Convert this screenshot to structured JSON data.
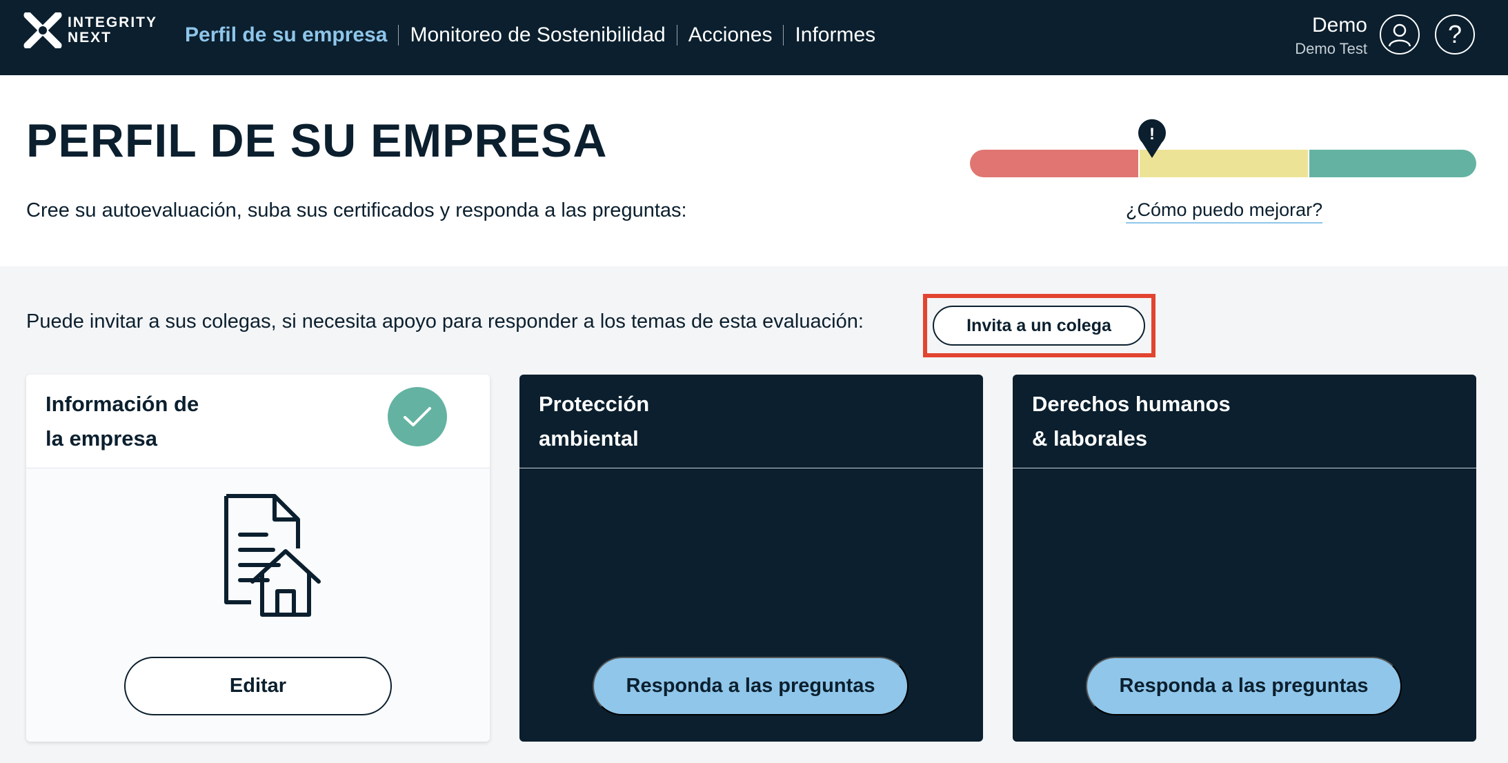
{
  "nav": {
    "logo_line1": "INTEGRITY",
    "logo_line2": "NEXT",
    "items": [
      {
        "label": "Perfil de su empresa",
        "active": true
      },
      {
        "label": "Monitoreo de Sostenibilidad"
      },
      {
        "label": "Acciones"
      },
      {
        "label": "Informes"
      }
    ],
    "user": {
      "name": "Demo",
      "org": "Demo Test"
    },
    "help_symbol": "?"
  },
  "header": {
    "title": "PERFIL DE SU EMPRESA",
    "subtitle": "Cree su autoevaluación, suba sus certificados y responda a las preguntas:",
    "improve_link": "¿Cómo puedo mejorar?",
    "marker_symbol": "!"
  },
  "invite": {
    "text": "Puede invitar a sus colegas, si necesita apoyo para responder a los temas de esta evaluación:",
    "button": "Invita a un colega"
  },
  "cards": [
    {
      "title_line1": "Información de",
      "title_line2": "la empresa",
      "button": "Editar",
      "completed": true
    },
    {
      "title_line1": "Protección",
      "title_line2": "ambiental",
      "button": "Responda a las preguntas"
    },
    {
      "title_line1": "Derechos humanos",
      "title_line2": "& laborales",
      "button": "Responda a las preguntas"
    }
  ],
  "colors": {
    "navy": "#0b1f2e",
    "accent_blue": "#8fc6ea",
    "red": "#e07571",
    "yellow": "#ede397",
    "green": "#64b3a2",
    "highlight": "#e2442f"
  }
}
